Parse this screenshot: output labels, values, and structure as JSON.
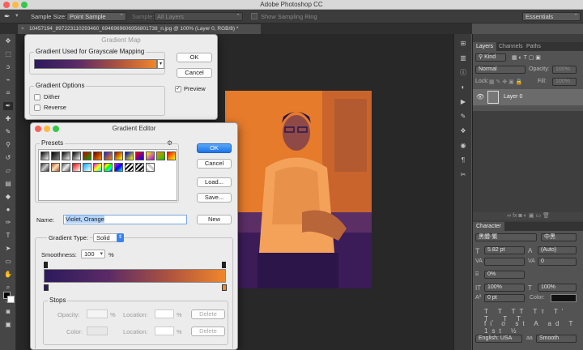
{
  "app": {
    "title": "Adobe Photoshop CC"
  },
  "options_bar": {
    "sample_size_label": "Sample Size:",
    "sample_size_value": "Point Sample",
    "sample_label": "Sample:",
    "sample_value": "All Layers",
    "show_ring_label": "Show Sampling Ring",
    "workspace": "Essentials"
  },
  "document": {
    "tab_title": "10457194_897223110293460_6946969606956801738_n.jpg @ 100% (Layer 0, RGB/8) *"
  },
  "gradient_map": {
    "title": "Gradient Map",
    "group_label": "Gradient Used for Grayscale Mapping",
    "options_label": "Gradient Options",
    "dither_label": "Dither",
    "reverse_label": "Reverse",
    "ok_label": "OK",
    "cancel_label": "Cancel",
    "preview_label": "Preview",
    "gradient_colors": [
      "#2c1a5c",
      "#f0862a"
    ]
  },
  "gradient_editor": {
    "title": "Gradient Editor",
    "presets_label": "Presets",
    "ok_label": "OK",
    "cancel_label": "Cancel",
    "load_label": "Load...",
    "save_label": "Save...",
    "name_label": "Name:",
    "name_value": "Violet, Orange",
    "new_label": "New",
    "gradient_type_label": "Gradient Type:",
    "gradient_type_value": "Solid",
    "smoothness_label": "Smoothness:",
    "smoothness_value": "100",
    "smoothness_unit": "%",
    "stops_label": "Stops",
    "opacity_label": "Opacity:",
    "color_label": "Color:",
    "location_label": "Location:",
    "percent": "%",
    "delete_label": "Delete",
    "start_color": "#2c1a5c",
    "end_color": "#f0862a"
  },
  "layers_panel": {
    "tabs": [
      "Layers",
      "Channels",
      "Paths"
    ],
    "kind_label": "Kind",
    "blend_mode": "Normal",
    "opacity_label": "Opacity:",
    "opacity_value": "100%",
    "lock_label": "Lock:",
    "fill_label": "Fill:",
    "fill_value": "100%",
    "layer_name": "Layer 0"
  },
  "character_panel": {
    "title": "Character",
    "font_family": "黑體-繁",
    "font_style": "中黑",
    "font_size": "5.82 pt",
    "leading": "(Auto)",
    "tracking": "0",
    "kerning_pct": "0%",
    "vertical_scale": "100%",
    "horizontal_scale": "100%",
    "baseline_shift": "0 pt",
    "color_label": "Color:",
    "language": "English: USA",
    "aa_label": "aa",
    "antialias": "Smooth"
  }
}
